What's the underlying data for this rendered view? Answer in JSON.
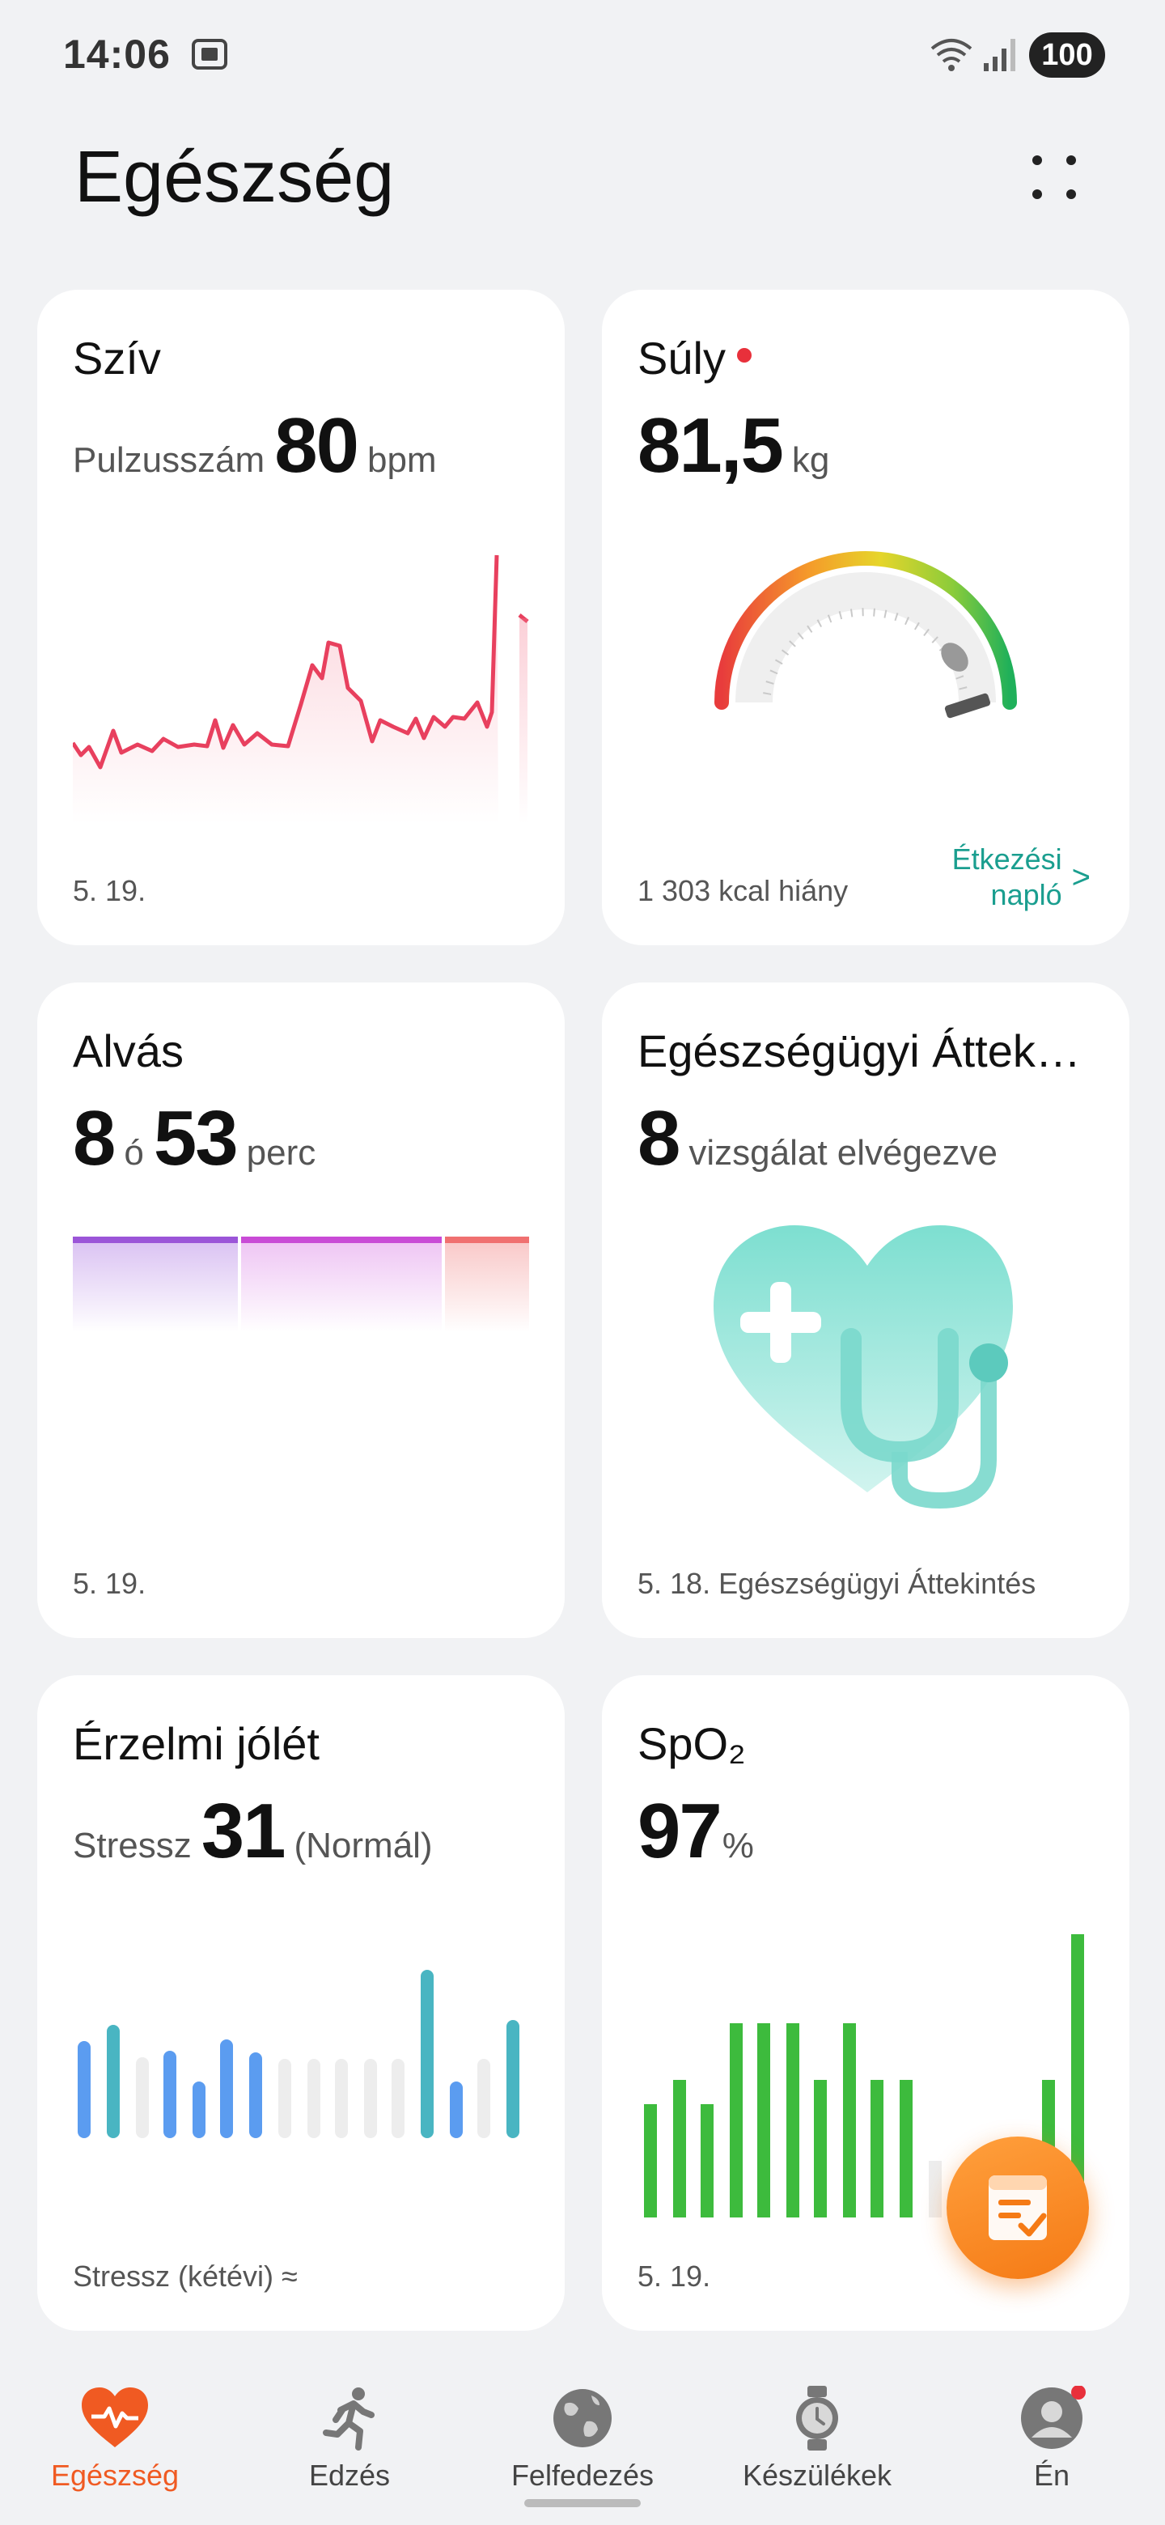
{
  "status_bar": {
    "time": "14:06",
    "battery": "100"
  },
  "header": {
    "title": "Egészség"
  },
  "cards": {
    "heart": {
      "title": "Szív",
      "metric_label": "Pulzusszám",
      "value": "80",
      "unit": "bpm",
      "date": "5. 19."
    },
    "weight": {
      "title": "Súly",
      "value": "81,5",
      "unit": "kg",
      "footer": "1 303 kcal hiány",
      "link": "Étkezési napló",
      "link_arrow": ">"
    },
    "sleep": {
      "title": "Alvás",
      "hours": "8",
      "hours_unit": "ó",
      "minutes": "53",
      "minutes_unit": "perc",
      "date": "5. 19."
    },
    "overview": {
      "title": "Egészségügyi Áttek…",
      "value": "8",
      "label": "vizsgálat elvégezve",
      "footer": "5. 18. Egészségügyi Áttekintés"
    },
    "emotion": {
      "title": "Érzelmi jólét",
      "metric_label": "Stressz",
      "value": "31",
      "status": "(Normál)",
      "footer": "Stressz (kétévi) ≈"
    },
    "spo2": {
      "title": "SpO₂",
      "value": "97",
      "unit": "%",
      "date": "5. 19."
    }
  },
  "nav": {
    "items": [
      {
        "label": "Egészség",
        "icon": "heart-pulse-icon",
        "active": true
      },
      {
        "label": "Edzés",
        "icon": "running-icon",
        "active": false
      },
      {
        "label": "Felfedezés",
        "icon": "globe-icon",
        "active": false
      },
      {
        "label": "Készülékek",
        "icon": "watch-icon",
        "active": false
      },
      {
        "label": "Én",
        "icon": "profile-icon",
        "active": false
      }
    ]
  },
  "colors": {
    "accent": "#f05a22",
    "heart_line": "#e8405e",
    "link": "#1a9e8f",
    "stress_blue": "#5b9cf0",
    "stress_teal": "#49b5c2",
    "spo2_green": "#3dbb3d"
  }
}
